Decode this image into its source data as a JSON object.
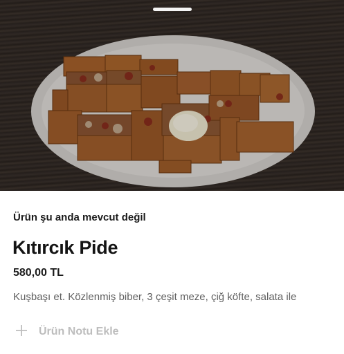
{
  "product": {
    "image": "kitircik-pide-photo",
    "availability_text": "Ürün şu anda mevcut değil",
    "name": "Kıtırcık Pide",
    "price": "580,00 TL",
    "description": "Kuşbaşı et. Közlenmiş biber, 3 çeşit meze, çiğ köfte, salata ile"
  },
  "note": {
    "icon": "plus-icon",
    "label": "Ürün Notu Ekle"
  }
}
